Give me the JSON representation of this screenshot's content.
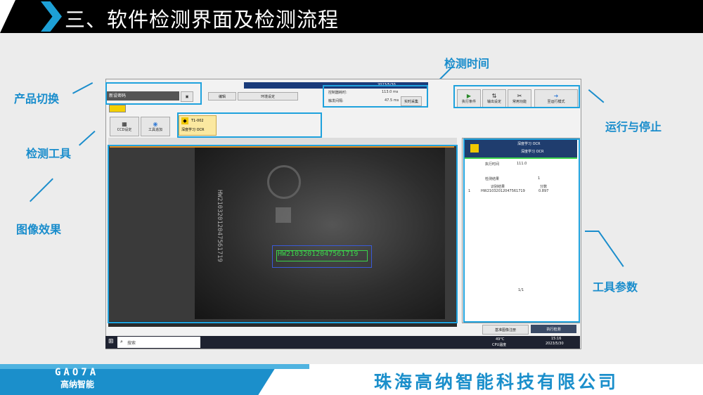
{
  "slide": {
    "title": "三、软件检测界面及检测流程",
    "company": "珠海高纳智能科技有限公司",
    "logo_main": "GAO7A",
    "logo_sub": "高纳智能"
  },
  "annotations": {
    "product_switch": "产品切换",
    "detect_tools": "检测工具",
    "image_effect": "图像效果",
    "detect_time": "检测时间",
    "run_stop": "运行与停止",
    "tool_params": "工具参数"
  },
  "app": {
    "product_field": "新设密码",
    "toolbar_left": [
      "编辑",
      "环境设定"
    ],
    "time_rows": [
      {
        "label": "控制器耗时:",
        "value": "113.0 ms"
      },
      {
        "label": "触发间隔:",
        "value": "47.5 ms"
      }
    ],
    "realtime_btn": "实时采集",
    "status_date": "2023/5/30",
    "right_buttons": [
      "执行条件",
      "输出设定",
      "常用功能",
      "至运行模式"
    ],
    "tool_buttons": [
      "CCD设定",
      "工具追加"
    ],
    "tool_item": {
      "id": "T1-002",
      "name": "深度学习 OCR"
    },
    "panel": {
      "header": "深度学习 OCR",
      "sub": "深度学习 OCR",
      "rows": [
        {
          "label": "执行时间",
          "value": "111.0"
        },
        {
          "label": "检测结果",
          "value": "1"
        }
      ],
      "table_head": [
        "识别结果",
        "分数"
      ],
      "table_row": {
        "index": "1",
        "text": "HW21032012047561719",
        "score": "0.897"
      },
      "pager": "1/1",
      "footer_btns": [
        "基准图像注册",
        "执行检测"
      ]
    },
    "ocr_text": "HW21032012047561719",
    "side_text": "HW21032012047561719",
    "search": "搜索",
    "clock_time": "15:16",
    "clock_date": "2023/5/30",
    "cpu_temp": "49°C",
    "cpu_label": "CPU温度"
  },
  "colors": {
    "accent": "#1a8dcc",
    "box": "#1fa2dd"
  }
}
